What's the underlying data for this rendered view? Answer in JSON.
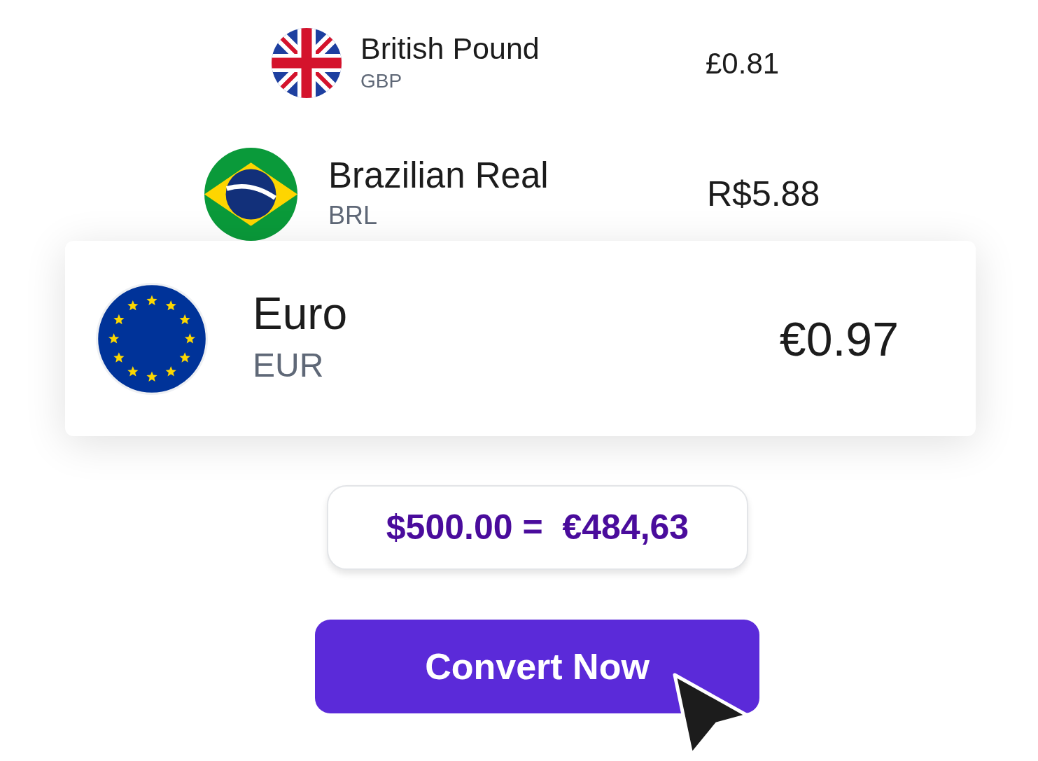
{
  "currencies": [
    {
      "name": "British Pound",
      "code": "GBP",
      "rate": "£0.81",
      "kind": "uk",
      "selected": false
    },
    {
      "name": "Brazilian Real",
      "code": "BRL",
      "rate": "R$5.88",
      "kind": "br",
      "selected": false
    },
    {
      "name": "Euro",
      "code": "EUR",
      "rate": "€0.97",
      "kind": "eu",
      "selected": true
    }
  ],
  "conversion": "$500.00 =  €484,63",
  "button": "Convert Now"
}
